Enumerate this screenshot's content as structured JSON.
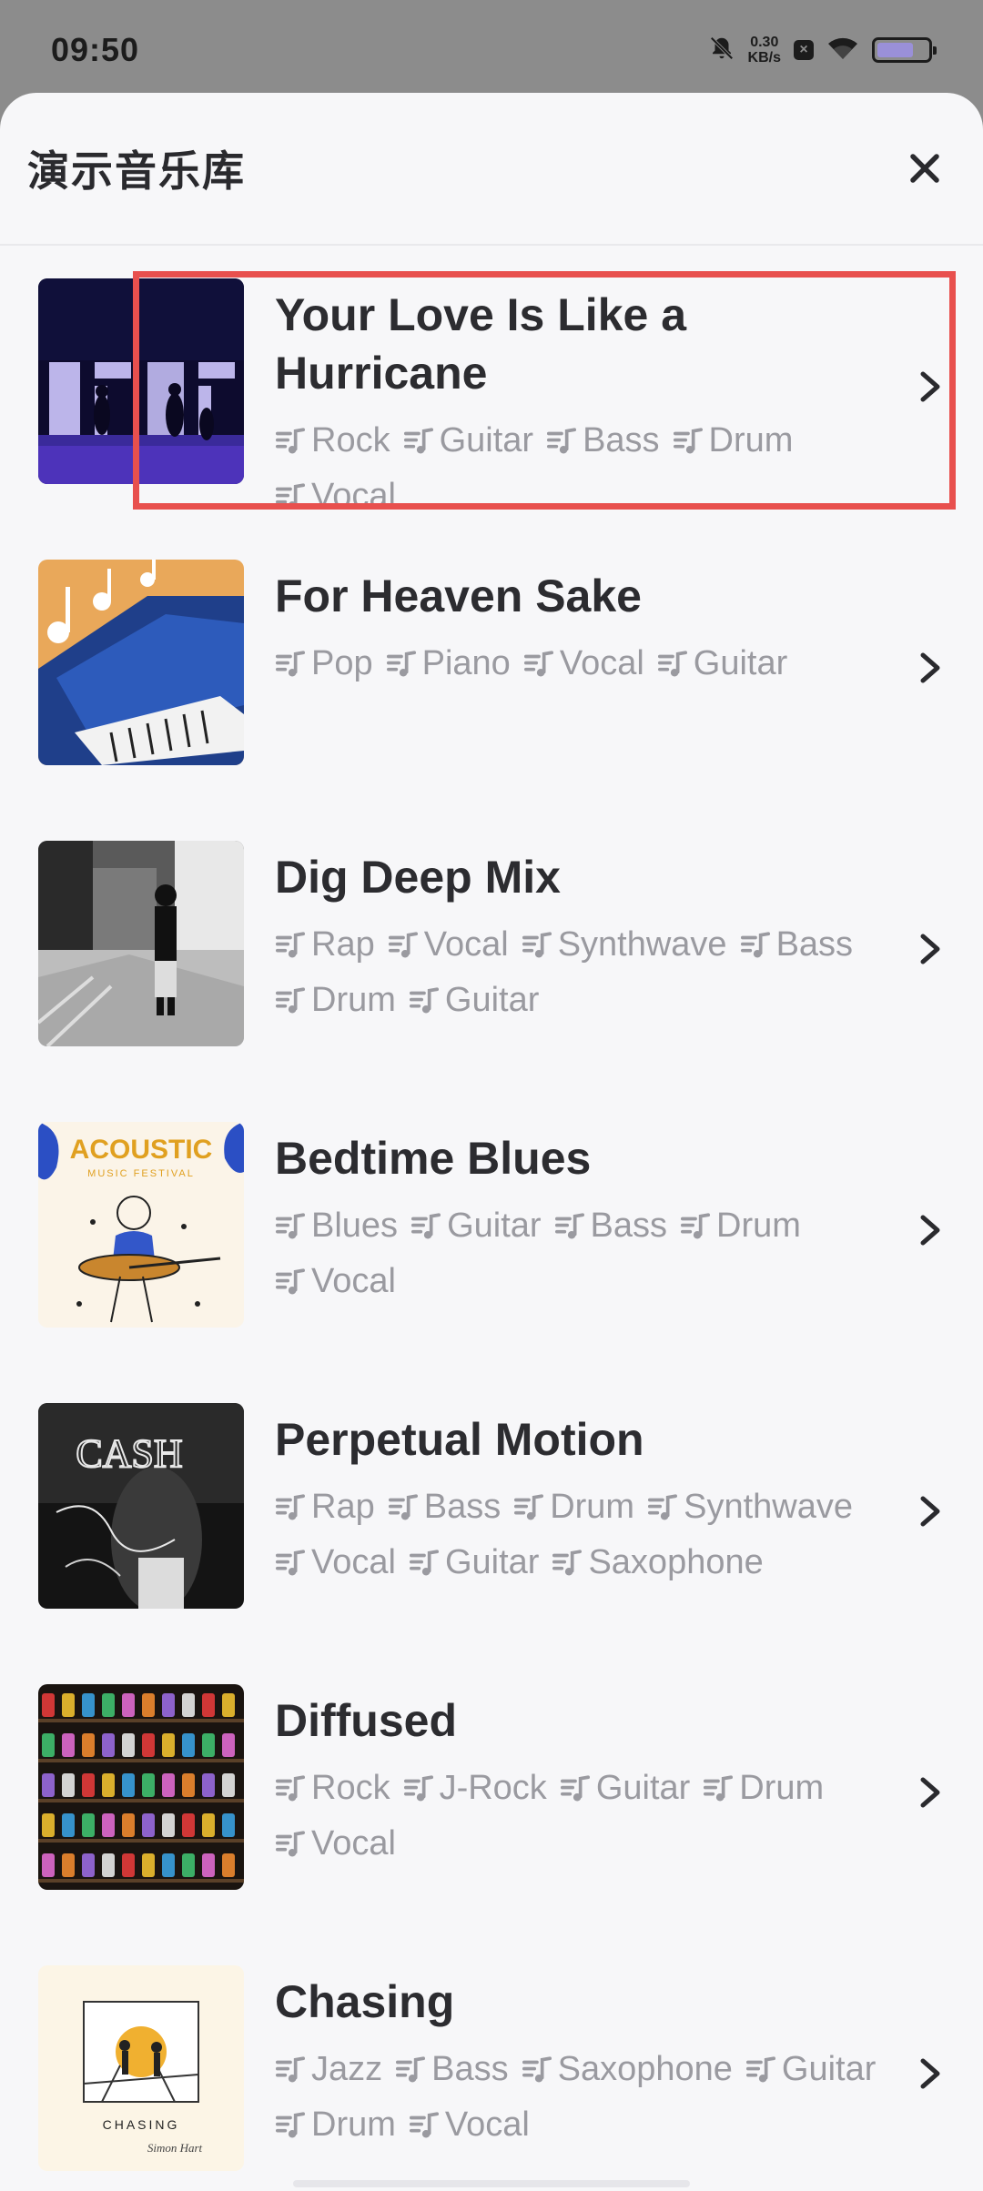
{
  "status_bar": {
    "time": "09:50",
    "net_speed_value": "0.30",
    "net_speed_unit": "KB/s",
    "battery_level": 0.72
  },
  "sheet": {
    "title": "演示音乐库"
  },
  "songs": [
    {
      "title": "Your Love Is Like a Hurricane",
      "tags": [
        "Rock",
        "Guitar",
        "Bass",
        "Drum",
        "Vocal"
      ]
    },
    {
      "title": "For Heaven Sake",
      "tags": [
        "Pop",
        "Piano",
        "Vocal",
        "Guitar"
      ]
    },
    {
      "title": "Dig Deep Mix",
      "tags": [
        "Rap",
        "Vocal",
        "Synthwave",
        "Bass",
        "Drum",
        "Guitar"
      ]
    },
    {
      "title": "Bedtime Blues",
      "tags": [
        "Blues",
        "Guitar",
        "Bass",
        "Drum",
        "Vocal"
      ]
    },
    {
      "title": "Perpetual Motion",
      "tags": [
        "Rap",
        "Bass",
        "Drum",
        "Synthwave",
        "Vocal",
        "Guitar",
        "Saxophone"
      ]
    },
    {
      "title": "Diffused",
      "tags": [
        "Rock",
        "J-Rock",
        "Guitar",
        "Drum",
        "Vocal"
      ]
    },
    {
      "title": "Chasing",
      "tags": [
        "Jazz",
        "Bass",
        "Saxophone",
        "Guitar",
        "Drum",
        "Vocal"
      ]
    }
  ],
  "cover_art": {
    "acoustic_title": "ACOUSTIC",
    "acoustic_subtitle": "MUSIC FESTIVAL",
    "perpetual_graffiti": "CASH",
    "chasing_title": "CHASING",
    "chasing_signature": "Simon Hart"
  },
  "colors": {
    "highlight": "#e8504e",
    "tag_text": "#9a9aa0",
    "title_text": "#2c2c30",
    "sheet_bg": "#f7f7f9"
  },
  "icons": {
    "tag": "music-note-list-icon",
    "row_action": "chevron-right-icon",
    "close": "close-icon"
  }
}
